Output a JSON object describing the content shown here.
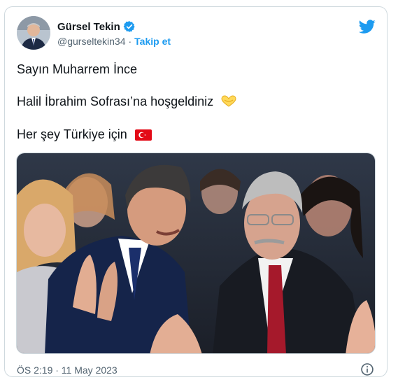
{
  "author": {
    "display_name": "Gürsel Tekin",
    "handle": "@gurseltekin34",
    "separator": "·",
    "follow_label": "Takip et"
  },
  "tweet": {
    "lines": [
      "Sayın Muharrem İnce",
      "Halil İbrahim Sofrası’na hoşgeldiniz",
      "Her şey Türkiye için"
    ],
    "emojis": [
      "handshake-heart-icon",
      "turkish-flag-icon"
    ]
  },
  "timestamp": "ÖS 2:19 · 11 May 2023",
  "colors": {
    "accent": "#1d9bf0",
    "secondary_text": "#536471",
    "border": "#cfd9de",
    "flag_red": "#e30a17"
  }
}
